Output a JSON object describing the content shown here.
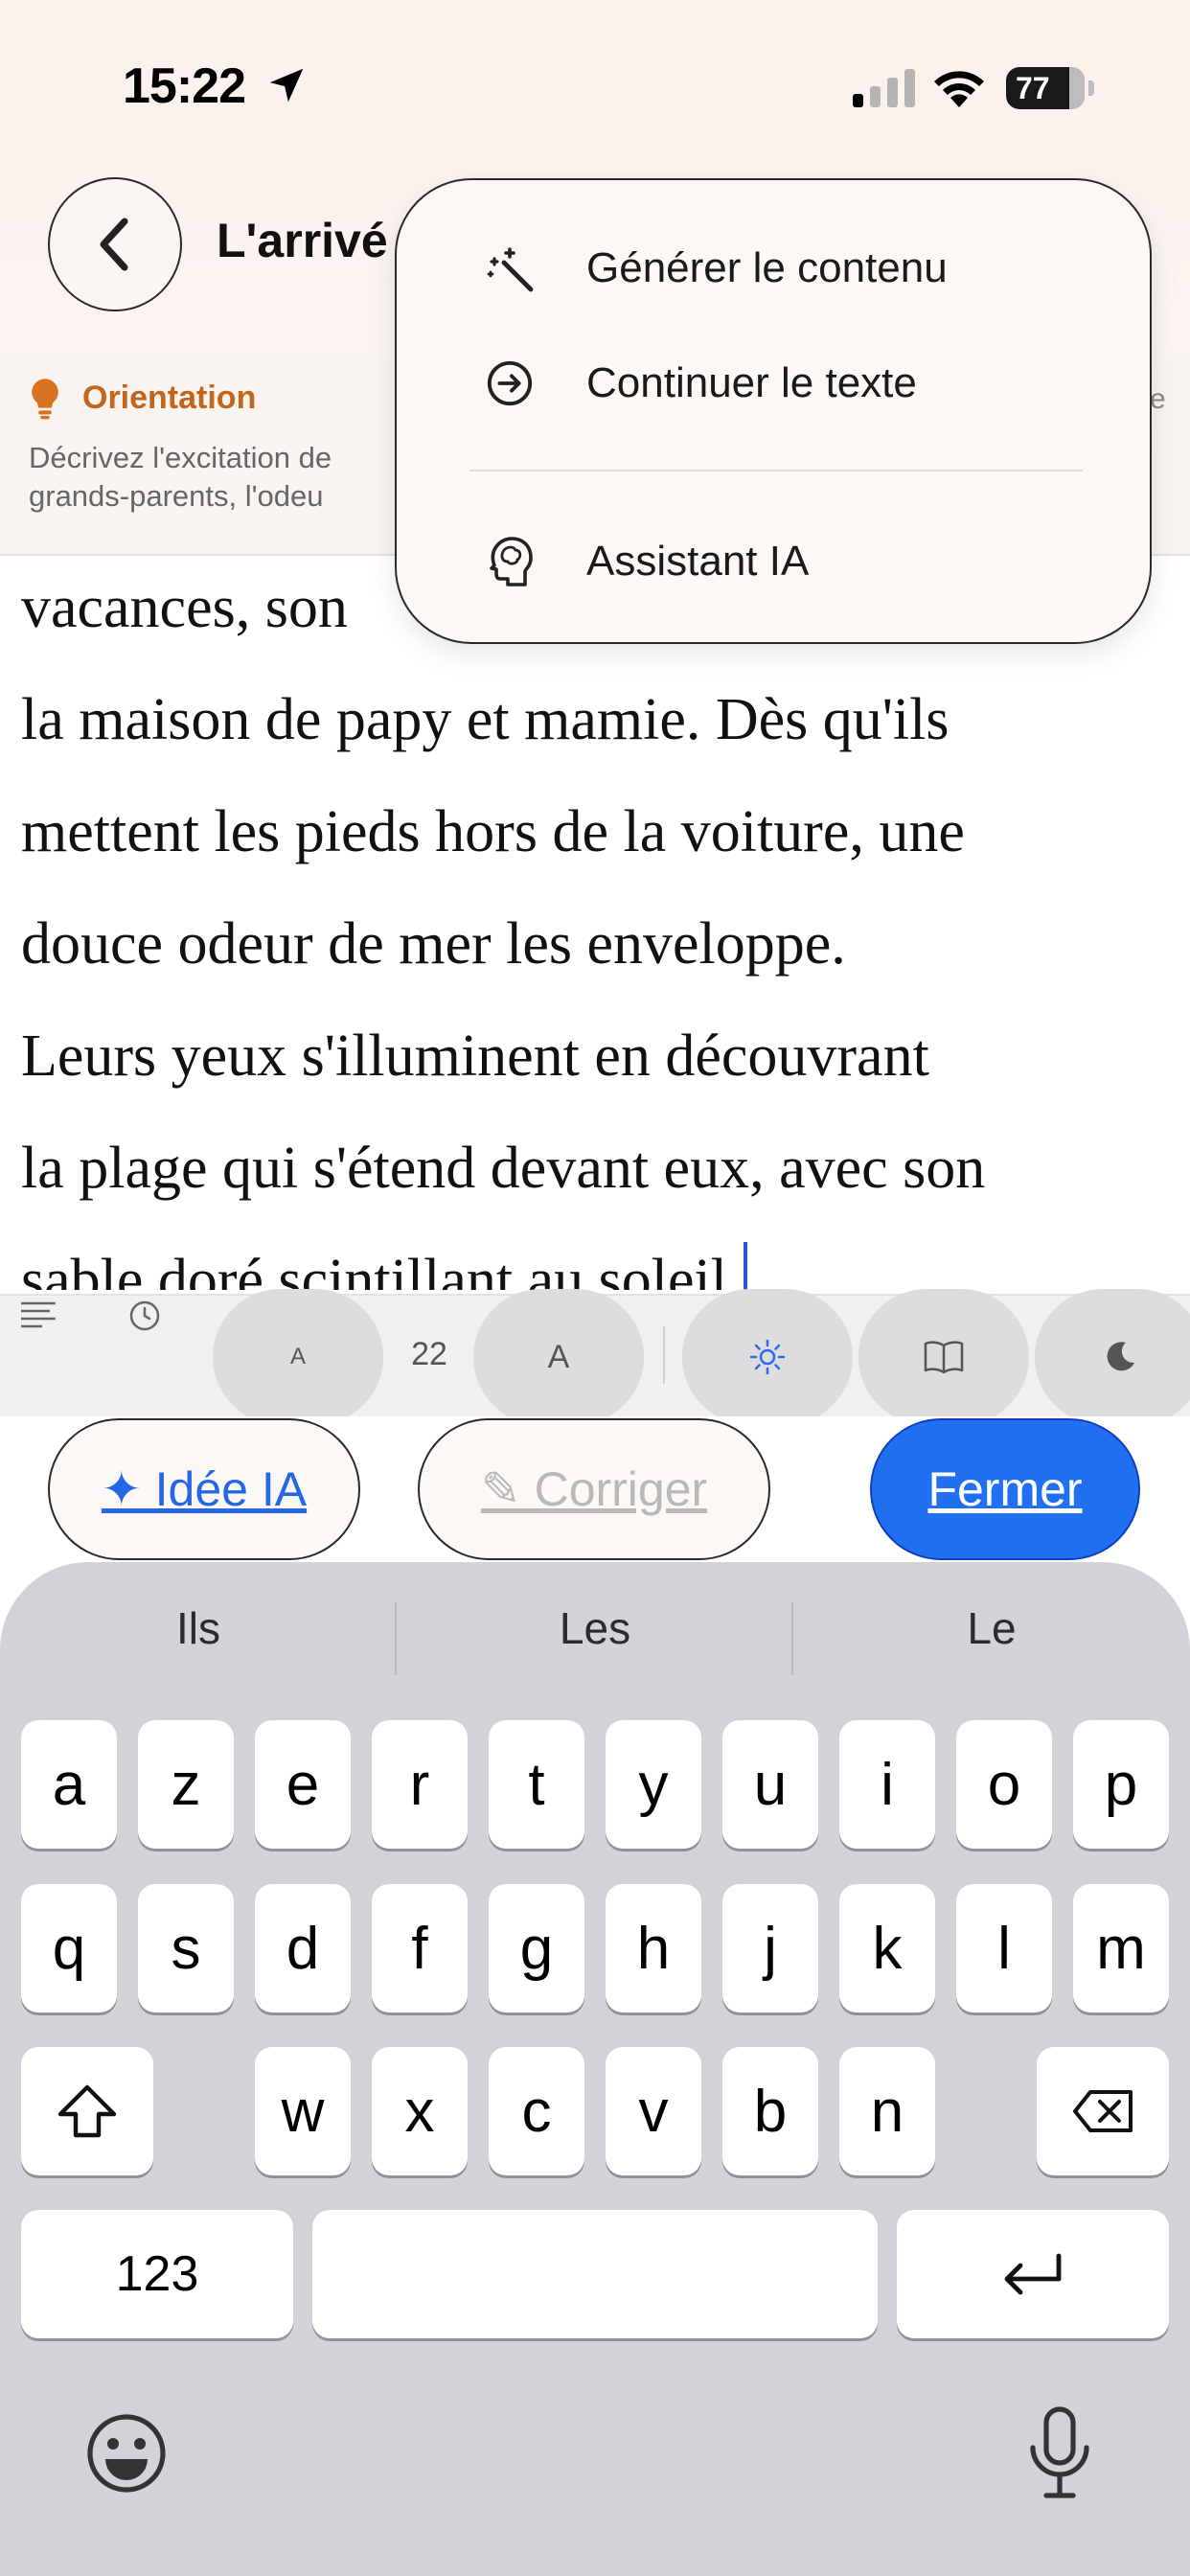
{
  "status_bar": {
    "time": "15:22",
    "battery": "77"
  },
  "header": {
    "title": "L'arrivé",
    "orientation_label": "Orientation",
    "orientation_text_line1": "Décrivez l'excitation de",
    "orientation_text_line2": "grands-parents, l'odeu",
    "right_glyph": "e"
  },
  "menu": {
    "items": [
      {
        "label": "Générer le contenu",
        "icon": "magic-wand-icon"
      },
      {
        "label": "Continuer le texte",
        "icon": "arrow-circle-right-icon"
      },
      {
        "label": "Assistant IA",
        "icon": "brain-head-icon"
      }
    ]
  },
  "editor": {
    "lines": [
      "vacances, son",
      "la maison de papy et mamie. Dès qu'ils",
      "mettent les pieds hors de la voiture, une",
      "douce odeur de mer les enveloppe.",
      "Leurs yeux s'illuminent en découvrant",
      "la plage qui s'étend devant eux, avec son",
      "sable doré scintillant au soleil."
    ]
  },
  "format_toolbar": {
    "decrease_label": "A",
    "font_size": "22",
    "increase_label": "A",
    "icons": [
      "paragraph-icon",
      "clock-icon",
      "sun-icon",
      "book-icon",
      "moon-icon"
    ]
  },
  "actions": {
    "idea_label": "✦ Idée IA",
    "fix_label": "✎ Corriger",
    "close_label": "Fermer"
  },
  "keyboard": {
    "suggestions": [
      "Ils",
      "Les",
      "Le"
    ],
    "row1": [
      "a",
      "z",
      "e",
      "r",
      "t",
      "y",
      "u",
      "i",
      "o",
      "p"
    ],
    "row2": [
      "q",
      "s",
      "d",
      "f",
      "g",
      "h",
      "j",
      "k",
      "l",
      "m"
    ],
    "row3": [
      "w",
      "x",
      "c",
      "v",
      "b",
      "n"
    ],
    "numbers_label": "123"
  }
}
